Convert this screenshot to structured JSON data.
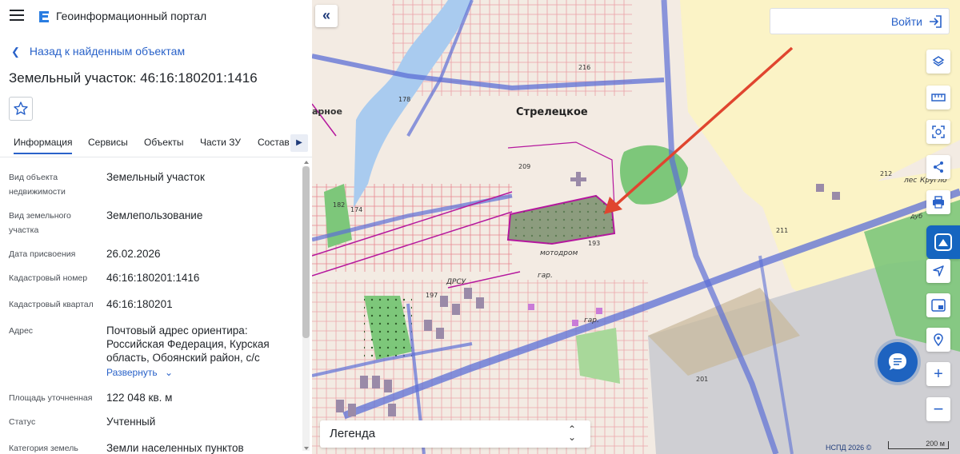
{
  "header": {
    "app_title": "Геоинформационный портал"
  },
  "nav": {
    "back_label": "Назад к найденным объектам"
  },
  "object": {
    "title": "Земельный участок: 46:16:180201:1416"
  },
  "tabs": [
    {
      "label": "Информация",
      "active": true
    },
    {
      "label": "Сервисы"
    },
    {
      "label": "Объекты"
    },
    {
      "label": "Части ЗУ"
    },
    {
      "label": "Состав"
    }
  ],
  "info": {
    "rows": [
      {
        "label": "Вид объекта недвижимости",
        "value": "Земельный участок"
      },
      {
        "label": "Вид земельного участка",
        "value": "Землепользование"
      },
      {
        "label": "Дата присвоения",
        "value": "26.02.2026"
      },
      {
        "label": "Кадастровый номер",
        "value": "46:16:180201:1416"
      },
      {
        "label": "Кадастровый квартал",
        "value": "46:16:180201"
      },
      {
        "label": "Адрес",
        "value": "Почтовый адрес ориентира: Российская Федерация, Курская область, Обоянский район, с/с",
        "expand": "Развернуть"
      },
      {
        "label": "Площадь уточненная",
        "value": "122 048 кв. м"
      },
      {
        "label": "Статус",
        "value": "Учтенный"
      },
      {
        "label": "Категория земель",
        "value": "Земли населенных пунктов"
      }
    ]
  },
  "map": {
    "login_label": "Войти",
    "legend_label": "Легенда",
    "copyright": "НСПД 2026 ©",
    "scale_label": "200 м",
    "labels": {
      "town": "Стрелецкое",
      "motodrom": "мотодром",
      "gar1": "гар.",
      "gar2": "гар.",
      "drsu": "ДРСУ",
      "les": "лес",
      "kruglo": "Кругло",
      "dub": "дуб",
      "n216": "216",
      "n178": "178",
      "n209": "209",
      "n193": "193",
      "n182": "182",
      "n174": "174",
      "n197": "197",
      "n212": "212",
      "n211": "211",
      "n201": "201",
      "arnoe": "арное"
    }
  },
  "colors": {
    "accent": "#2962c9",
    "arrow": "#e0452f",
    "parcel_outline": "#b5179e",
    "road": "#5c6fd6",
    "forest": "#7dc77a",
    "field": "#fbf3c6"
  }
}
